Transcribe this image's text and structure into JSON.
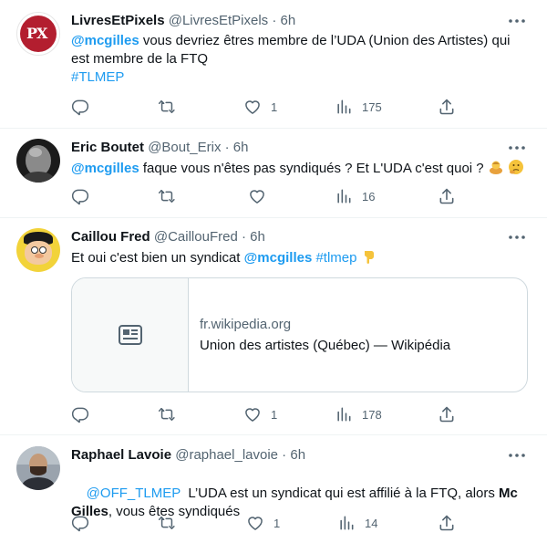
{
  "colors": {
    "accent": "#1d9bf0",
    "muted": "#536471",
    "text": "#0f1419",
    "border": "#eff3f4"
  },
  "tweets": [
    {
      "name": "LivresEtPixels",
      "meta": "@LivresEtPixels · 6h",
      "avatar_text": "PX",
      "text": {
        "mention": "@mcgilles",
        "line1": " vous devriez êtres membre de l’UDA (Union des Artistes) qui",
        "line2": "est membre de la FTQ",
        "hashtag": "#TLMEP"
      },
      "likes": "1",
      "views": "175"
    },
    {
      "name": "Eric Boutet",
      "meta": "@Bout_Erix · 6h",
      "text": {
        "mention": "@mcgilles",
        "line1": " faque vous n'êtes pas syndiqués ? Et L'UDA c'est quoi ?"
      },
      "views": "16"
    },
    {
      "name": "Caillou Fred",
      "meta": "@CaillouFred · 6h",
      "text": {
        "before": "Et oui c'est bien un syndicat ",
        "mention": "@mcgilles",
        "hashtag": "#tlmep"
      },
      "card": {
        "domain": "fr.wikipedia.org",
        "title": "Union des artistes (Québec) — Wikipédia"
      },
      "likes": "1",
      "views": "178"
    },
    {
      "name": "Raphael Lavoie",
      "meta": "@raphael_lavoie · 6h",
      "text": {
        "mention": "@OFF_TLMEP",
        "line1": "  L’UDA est un syndicat qui est affilié à la FTQ, alors ",
        "bold1": "Mc",
        "bold2": "Gilles",
        "line2": ", vous êtes syndiqués"
      },
      "likes": "1",
      "views": "14"
    }
  ]
}
